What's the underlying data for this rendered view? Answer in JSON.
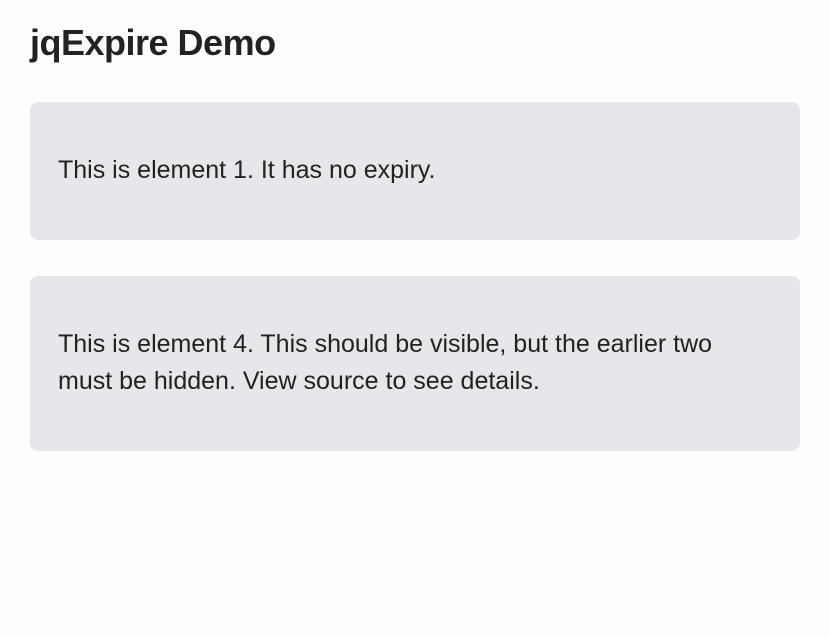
{
  "header": {
    "title": "jqExpire Demo"
  },
  "cards": [
    {
      "text": "This is element 1. It has no expiry."
    },
    {
      "text": "This is element 4. This should be visible, but the earlier two must be hidden. View source to see details."
    }
  ]
}
